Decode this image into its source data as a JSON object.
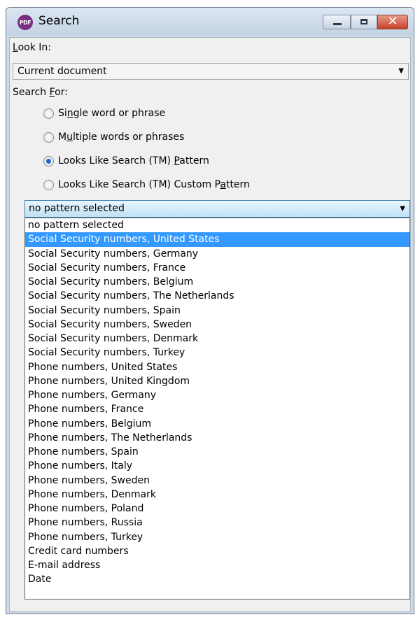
{
  "window": {
    "title": "Search",
    "app_icon_text": "PDF",
    "minimize_icon": "minimize-icon",
    "maximize_icon": "maximize-icon",
    "close_icon": "close-icon",
    "close_glyph": "✕"
  },
  "look_in": {
    "label_pre": "",
    "label_key": "L",
    "label_post": "ook In:",
    "value": "Current document"
  },
  "search_for": {
    "label_pre": "Search ",
    "label_key": "F",
    "label_post": "or:",
    "options": [
      {
        "pre": "Si",
        "key": "n",
        "post": "gle word or phrase",
        "checked": false
      },
      {
        "pre": "M",
        "key": "u",
        "post": "ltiple words or phrases",
        "checked": false
      },
      {
        "pre": "Looks Like Search (TM) ",
        "key": "P",
        "post": "attern",
        "checked": true
      },
      {
        "pre": "Looks Like Search (TM) Custom P",
        "key": "a",
        "post": "ttern",
        "checked": false
      }
    ]
  },
  "pattern": {
    "value": "no pattern selected",
    "selected_index": 1,
    "options": [
      "no pattern selected",
      "Social Security numbers, United States",
      "Social Security numbers, Germany",
      "Social Security numbers, France",
      "Social Security numbers, Belgium",
      "Social Security numbers, The Netherlands",
      "Social Security numbers, Spain",
      "Social Security numbers, Sweden",
      "Social Security numbers, Denmark",
      "Social Security numbers, Turkey",
      "Phone numbers, United States",
      "Phone numbers, United Kingdom",
      "Phone numbers, Germany",
      "Phone numbers, France",
      "Phone numbers, Belgium",
      "Phone numbers, The Netherlands",
      "Phone numbers, Spain",
      "Phone numbers, Italy",
      "Phone numbers, Sweden",
      "Phone numbers, Denmark",
      "Phone numbers, Poland",
      "Phone numbers, Russia",
      "Phone numbers, Turkey",
      "Credit card numbers",
      "E-mail address",
      "Date"
    ]
  },
  "colors": {
    "selection": "#3399ff",
    "app_icon": "#7b2d86",
    "close_button": "#c8432c"
  }
}
